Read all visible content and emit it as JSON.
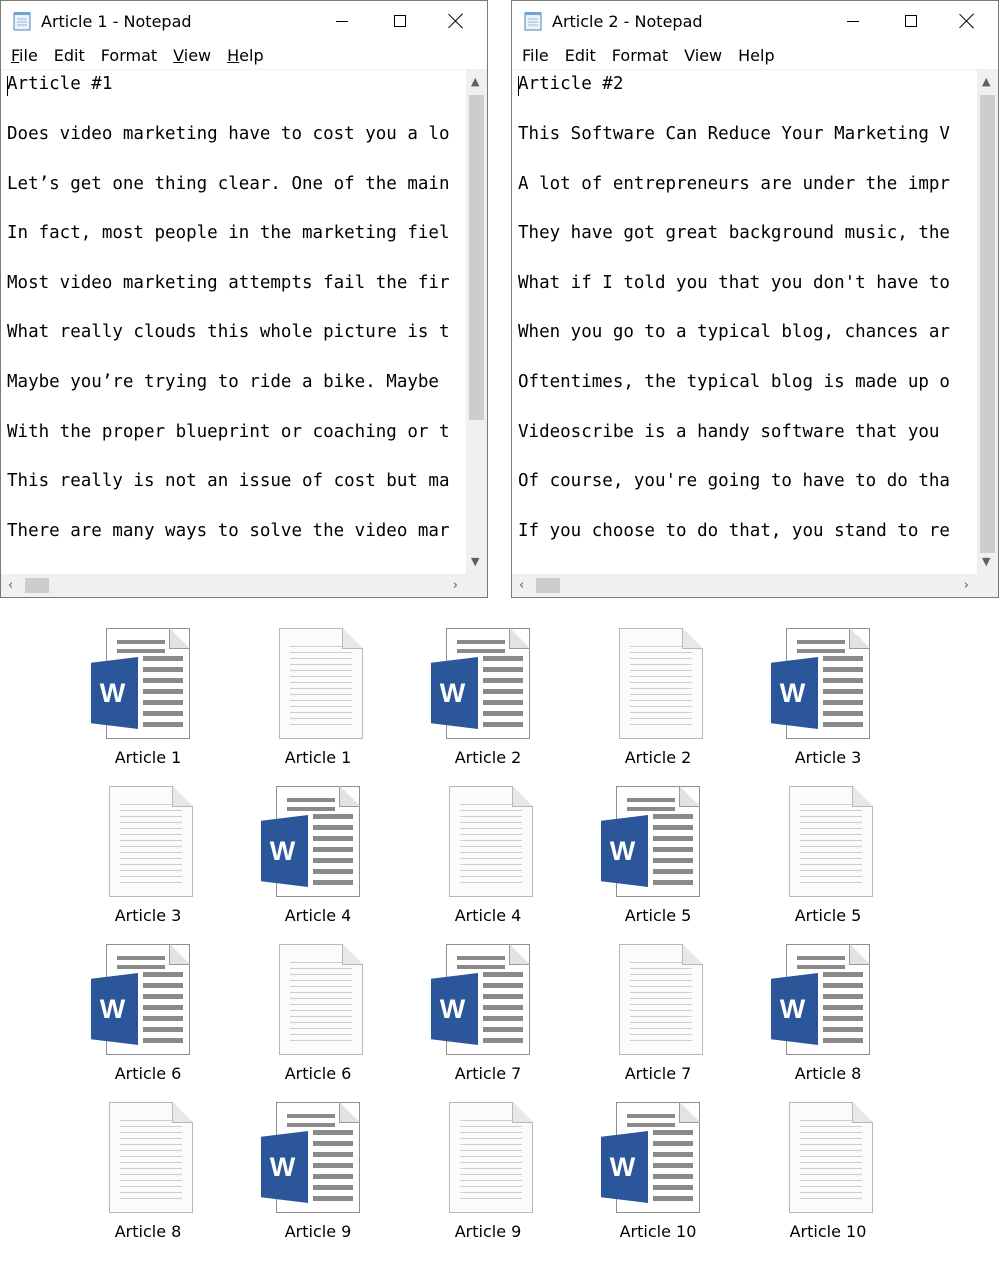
{
  "windows": [
    {
      "title": "Article 1 - Notepad",
      "menu": [
        {
          "u": "F",
          "rest": "ile"
        },
        {
          "u": "",
          "rest": "Edit"
        },
        {
          "u": "",
          "rest": "Format"
        },
        {
          "u": "V",
          "rest": "iew"
        },
        {
          "u": "H",
          "rest": "elp"
        }
      ],
      "lines": [
        "Article #1",
        "Does video marketing have to cost you a lo",
        "Let’s get one thing clear. One of the main",
        "In fact, most people in the marketing fiel",
        "Most video marketing attempts fail the fir",
        "What really clouds this whole picture is t",
        "Maybe you’re trying to ride a bike. Maybe",
        "With the proper blueprint or coaching or t",
        "This really is not an issue of cost but ma",
        "There are many ways to solve the video mar"
      ]
    },
    {
      "title": "Article 2 - Notepad",
      "menu": [
        {
          "u": "",
          "rest": "File"
        },
        {
          "u": "",
          "rest": "Edit"
        },
        {
          "u": "",
          "rest": "Format"
        },
        {
          "u": "",
          "rest": "View"
        },
        {
          "u": "",
          "rest": "Help"
        }
      ],
      "lines": [
        "Article #2",
        "This Software Can Reduce Your Marketing V",
        "A lot of entrepreneurs are under the impr",
        "They have got great background music, the",
        "What if I told you that you don't have to",
        "When you go to a typical blog, chances ar",
        "Oftentimes, the typical blog is made up o",
        "Videoscribe is a handy software that you",
        "Of course, you're going to have to do tha",
        "If you choose to do that, you stand to re"
      ]
    }
  ],
  "files": [
    {
      "label": "Article 1",
      "icon": "word-doc-icon"
    },
    {
      "label": "Article 1",
      "icon": "text-file-icon"
    },
    {
      "label": "Article 2",
      "icon": "word-doc-icon"
    },
    {
      "label": "Article 2",
      "icon": "text-file-icon"
    },
    {
      "label": "Article 3",
      "icon": "word-doc-icon"
    },
    {
      "label": "Article 3",
      "icon": "text-file-icon"
    },
    {
      "label": "Article 4",
      "icon": "word-doc-icon"
    },
    {
      "label": "Article 4",
      "icon": "text-file-icon"
    },
    {
      "label": "Article 5",
      "icon": "word-doc-icon"
    },
    {
      "label": "Article 5",
      "icon": "text-file-icon"
    },
    {
      "label": "Article 6",
      "icon": "word-doc-icon"
    },
    {
      "label": "Article 6",
      "icon": "text-file-icon"
    },
    {
      "label": "Article 7",
      "icon": "word-doc-icon"
    },
    {
      "label": "Article 7",
      "icon": "text-file-icon"
    },
    {
      "label": "Article 8",
      "icon": "word-doc-icon"
    },
    {
      "label": "Article 8",
      "icon": "text-file-icon"
    },
    {
      "label": "Article 9",
      "icon": "word-doc-icon"
    },
    {
      "label": "Article 9",
      "icon": "text-file-icon"
    },
    {
      "label": "Article 10",
      "icon": "word-doc-icon"
    },
    {
      "label": "Article 10",
      "icon": "text-file-icon"
    }
  ],
  "word_letter": "W",
  "colors": {
    "word_blue": "#2b579a"
  }
}
